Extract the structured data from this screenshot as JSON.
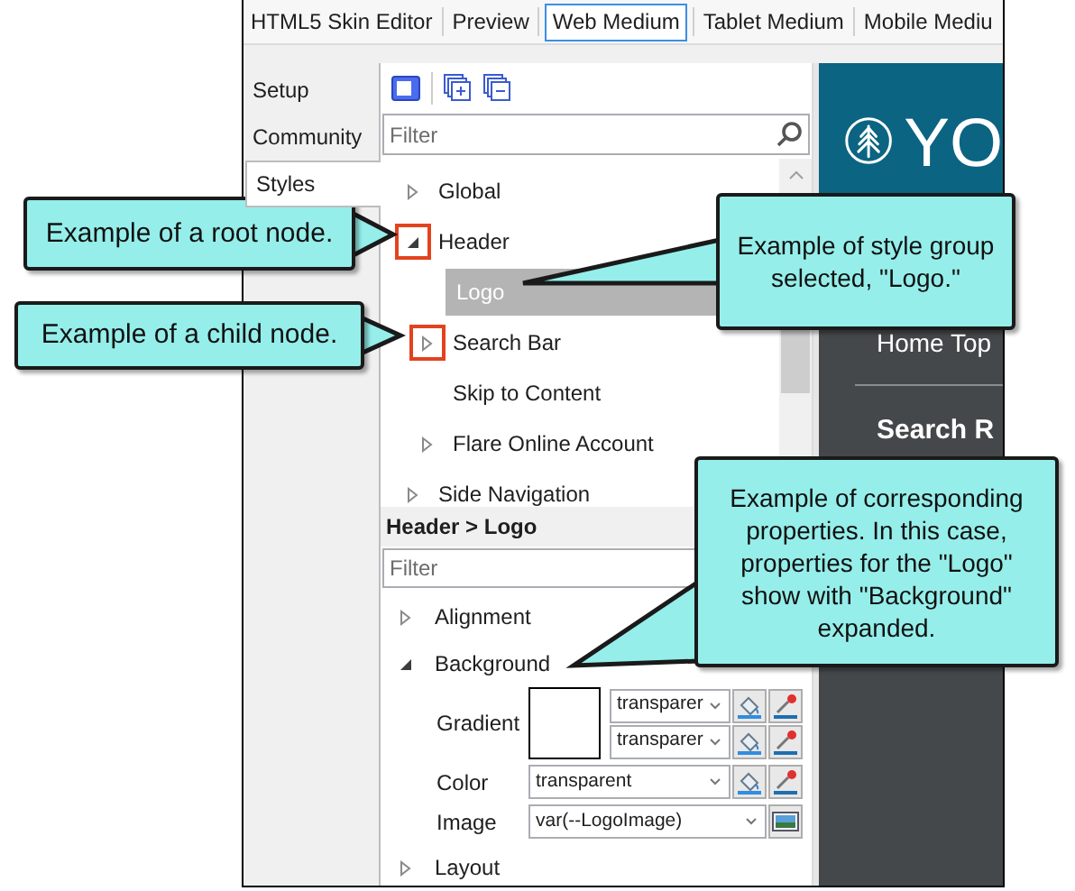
{
  "top_tabs": [
    {
      "label": "HTML5 Skin Editor",
      "selected": false
    },
    {
      "label": "Preview",
      "selected": false
    },
    {
      "label": "Web Medium",
      "selected": true
    },
    {
      "label": "Tablet Medium",
      "selected": false
    },
    {
      "label": "Mobile Mediu",
      "selected": false
    }
  ],
  "side_tabs": [
    {
      "label": "Setup",
      "selected": false
    },
    {
      "label": "Community",
      "selected": false
    },
    {
      "label": "Styles",
      "selected": true
    }
  ],
  "styles_filter": {
    "placeholder": "Filter"
  },
  "tree": [
    {
      "label": "Global",
      "kind": "group",
      "expanded": false,
      "selected": false,
      "highlight": false
    },
    {
      "label": "Header",
      "kind": "group",
      "expanded": true,
      "selected": false,
      "highlight": true,
      "children": [
        {
          "label": "Logo",
          "kind": "leaf",
          "selected": true,
          "highlight": false
        },
        {
          "label": "Search Bar",
          "kind": "group",
          "expanded": false,
          "selected": false,
          "highlight": true
        },
        {
          "label": "Skip to Content",
          "kind": "leaf",
          "selected": false,
          "highlight": false
        },
        {
          "label": "Flare Online Account",
          "kind": "group",
          "expanded": false,
          "selected": false,
          "highlight": false
        }
      ]
    },
    {
      "label": "Side Navigation",
      "kind": "group",
      "expanded": false,
      "selected": false,
      "highlight": false
    }
  ],
  "breadcrumb": "Header > Logo",
  "properties_filter": {
    "placeholder": "Filter"
  },
  "properties": [
    {
      "label": "Alignment",
      "expanded": false
    },
    {
      "label": "Background",
      "expanded": true,
      "fields": [
        {
          "label": "Gradient",
          "kind": "gradient",
          "values": [
            "transparer",
            "transparer"
          ]
        },
        {
          "label": "Color",
          "kind": "color",
          "values": [
            "transparent"
          ]
        },
        {
          "label": "Image",
          "kind": "image",
          "values": [
            "var(--LogoImage)"
          ]
        }
      ]
    },
    {
      "label": "Layout",
      "expanded": false
    }
  ],
  "preview": {
    "brand": "YO",
    "nav_text": "Home Top",
    "search_text": "Search R"
  },
  "callouts": [
    {
      "text": "Example of a root node."
    },
    {
      "text": "Example of style group selected, \"Logo.\""
    },
    {
      "text": "Example of a child node."
    },
    {
      "text": "Example of corresponding properties. In this case, properties for the \"Logo\" show with \"Background\" expanded."
    }
  ]
}
